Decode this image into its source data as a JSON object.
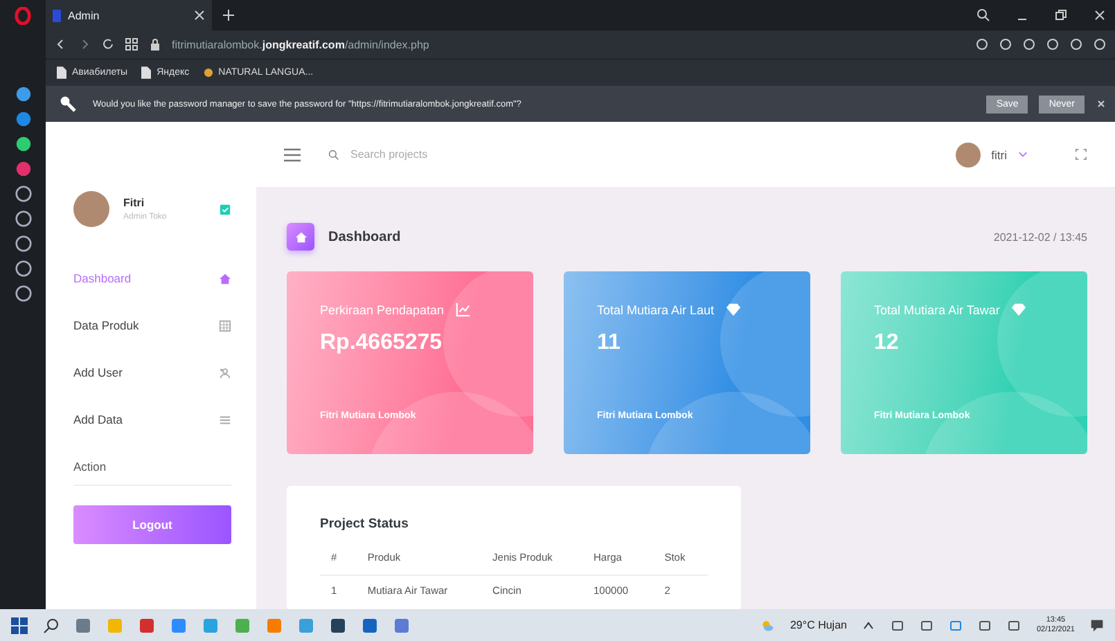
{
  "browser": {
    "tab_title": "Admin",
    "url": "fitrimutiaralombok.**jongkreatif.com**/admin/index.php",
    "bookmarks": [
      "Авиабилеты",
      "Яндекс",
      "NATURAL LANGUA..."
    ],
    "password_prompt": {
      "message": "Would you like the password manager to save the password for \"https://fitrimutiaralombok.jongkreatif.com\"?",
      "buttons": [
        "Save",
        "Never"
      ]
    }
  },
  "header": {
    "search": {
      "placeholder": "Search projects"
    },
    "user": "fitri"
  },
  "sidebar": {
    "profile": {
      "name": "Fitri",
      "role": "Admin Toko"
    },
    "items": [
      {
        "label": "Dashboard",
        "selected": true
      },
      {
        "label": "Data Produk",
        "selected": false
      },
      {
        "label": "Add User",
        "selected": false
      },
      {
        "label": "Add Data",
        "selected": false
      }
    ],
    "section": "Action",
    "logout": "Logout"
  },
  "page": {
    "title": "Dashboard",
    "datetime": "2021-12-02 / 13:45"
  },
  "cards": [
    {
      "title": "Perkiraan Pendapatan",
      "value": "Rp.4665275",
      "footer": "Fitri Mutiara Lombok",
      "color": "#fe7096"
    },
    {
      "title": "Total Mutiara Air Laut",
      "value": "11",
      "footer": "Fitri Mutiara Lombok",
      "color": "#2f8ee4"
    },
    {
      "title": "Total Mutiara Air Tawar",
      "value": "12",
      "footer": "Fitri Mutiara Lombok",
      "color": "#2ed1b3"
    }
  ],
  "table": {
    "title": "Project Status",
    "columns": [
      "#",
      "Produk",
      "Jenis Produk",
      "Harga",
      "Stok"
    ],
    "rows": [
      [
        "1",
        "Mutiara Air Tawar",
        "Cincin",
        "100000",
        "2"
      ]
    ]
  },
  "taskbar": {
    "weather": "29°C Hujan",
    "time": "13:45",
    "date": "02/12/2021"
  }
}
